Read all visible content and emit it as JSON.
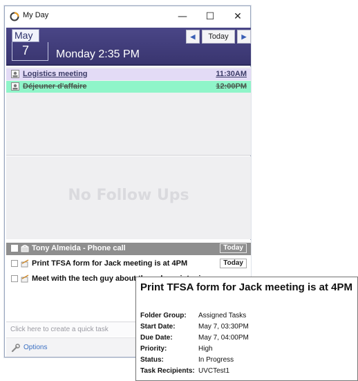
{
  "window": {
    "title": "My Day",
    "controls": {
      "minimize": "—",
      "maximize": "☐",
      "close": "✕"
    }
  },
  "date_header": {
    "month": "May",
    "day": "7",
    "label": "Monday 2:35 PM",
    "prev_icon": "◀",
    "today_label": "Today",
    "next_icon": "▶"
  },
  "appointments": [
    {
      "subject": "Logistics meeting",
      "time": "11:30AM",
      "strikethrough": false,
      "color": "#e3dbf6"
    },
    {
      "subject": "Déjeuner d'affaire",
      "time": "12:00PM",
      "strikethrough": true,
      "color": "#8ff5c9"
    }
  ],
  "followups": {
    "empty_text": "No Follow Ups"
  },
  "tasks": [
    {
      "subject": "Tony Almeida - Phone call",
      "due": "Today",
      "selected": true
    },
    {
      "subject": "Print TFSA form for Jack meeting is at 4PM",
      "due": "Today",
      "selected": false
    },
    {
      "subject": "Meet with the tech guy about the color printer issue",
      "due": "",
      "selected": false
    }
  ],
  "quick_task": {
    "placeholder": "Click here to create a quick task"
  },
  "options": {
    "label": "Options"
  },
  "tooltip": {
    "title": "Print TFSA form for Jack meeting is at 4PM",
    "fields": [
      {
        "key": "Folder Group:",
        "value": "Assigned Tasks"
      },
      {
        "key": "Start Date:",
        "value": "May 7, 03:30PM"
      },
      {
        "key": "Due Date:",
        "value": "May 7, 04:00PM"
      },
      {
        "key": "Priority:",
        "value": "High"
      },
      {
        "key": "Status:",
        "value": "In Progress"
      },
      {
        "key": "Task Recipients:",
        "value": "UVCTest1"
      }
    ]
  },
  "colors": {
    "header_bg": "#3f3b7a",
    "selected_task_bg": "#8e8e8e",
    "link_blue": "#3a6fc2"
  }
}
